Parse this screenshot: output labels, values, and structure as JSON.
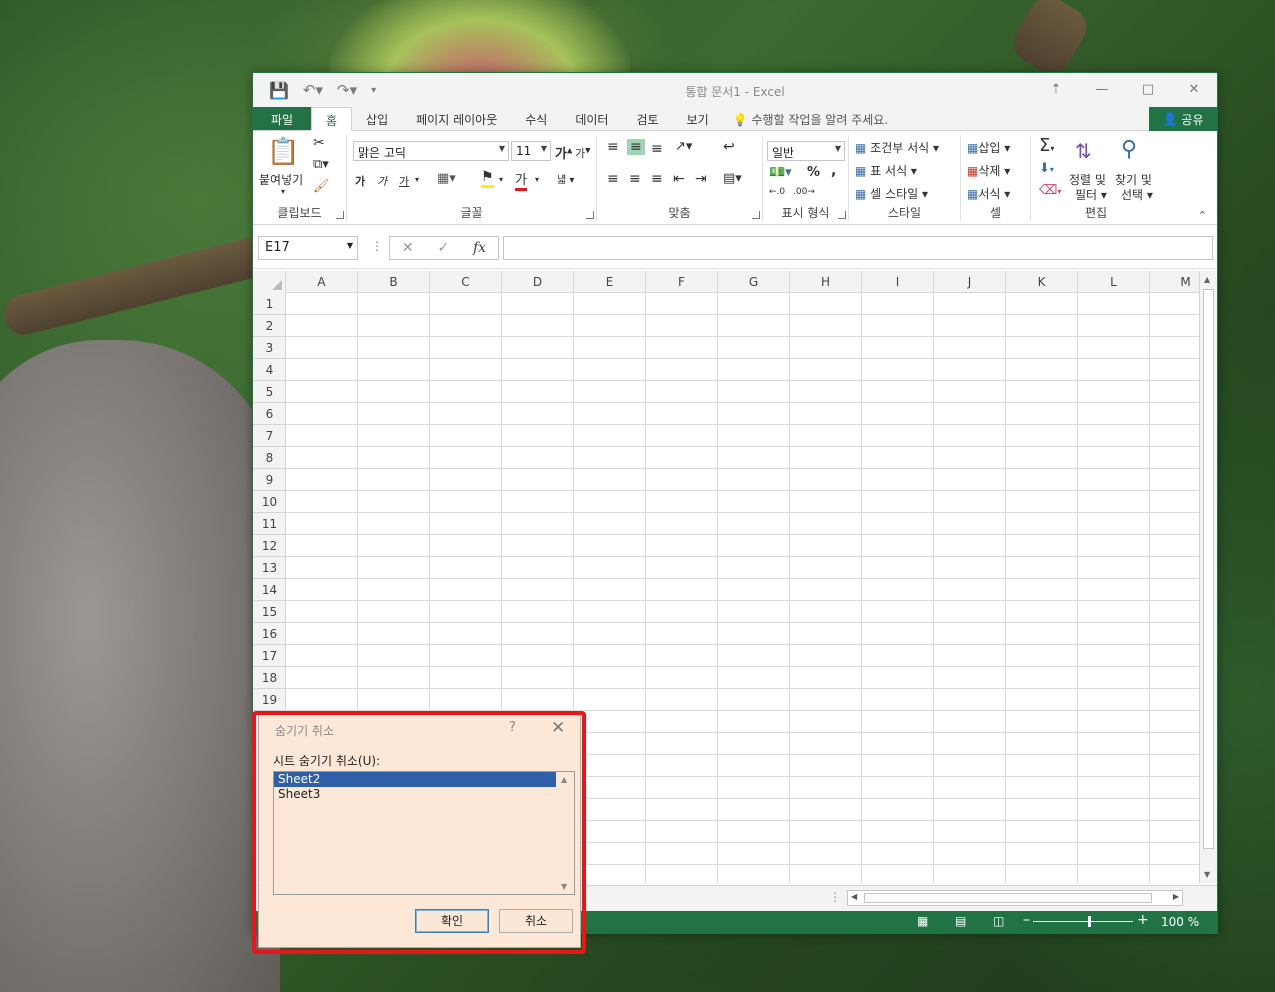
{
  "window": {
    "title": "통합 문서1 - Excel"
  },
  "tabs": [
    {
      "label": "파일"
    },
    {
      "label": "홈"
    },
    {
      "label": "삽입"
    },
    {
      "label": "페이지 레이아웃"
    },
    {
      "label": "수식"
    },
    {
      "label": "데이터"
    },
    {
      "label": "검토"
    },
    {
      "label": "보기"
    }
  ],
  "tellme": "수행할 작업을 알려 주세요.",
  "share": "공유",
  "ribbon": {
    "clipboard": {
      "paste": "붙여넣기",
      "label": "클립보드"
    },
    "font": {
      "name": "맑은 고딕",
      "size": "11",
      "bold": "가",
      "italic": "가",
      "underline": "가",
      "grow": "가",
      "shrink": "가",
      "color_letter": "가",
      "label": "글꼴"
    },
    "alignment": {
      "wrap": "냷",
      "label": "맞춤"
    },
    "number": {
      "format": "일반",
      "percent": "%",
      "comma": ",",
      "label": "표시 형식"
    },
    "styles": {
      "conditional": "조건부 서식",
      "table": "표 서식",
      "cell": "셀 스타일",
      "label": "스타일"
    },
    "cells": {
      "insert": "삽입",
      "delete": "삭제",
      "format": "서식",
      "label": "셀"
    },
    "editing": {
      "sort": "정렬 및",
      "sort2": "필터",
      "find": "찾기 및",
      "find2": "선택",
      "label": "편집"
    }
  },
  "formula": {
    "namebox": "E17",
    "value": ""
  },
  "columns": [
    "A",
    "B",
    "C",
    "D",
    "E",
    "F",
    "G",
    "H",
    "I",
    "J",
    "K",
    "L",
    "M"
  ],
  "rows": [
    "1",
    "2",
    "3",
    "4",
    "5",
    "6",
    "7",
    "8",
    "9",
    "10",
    "11",
    "12",
    "13",
    "14",
    "15",
    "16",
    "17",
    "18",
    "19"
  ],
  "status": {
    "zoom": "100 %"
  },
  "dialog": {
    "title": "숨기기 취소",
    "help": "?",
    "list_label": "시트 숨기기 취소(U):",
    "items": [
      "Sheet2",
      "Sheet3"
    ],
    "selected": "Sheet2",
    "ok": "확인",
    "cancel": "취소"
  },
  "colors": {
    "excel_green": "#217346",
    "highlight": "#e8161a",
    "selection": "#2f5fa8"
  }
}
